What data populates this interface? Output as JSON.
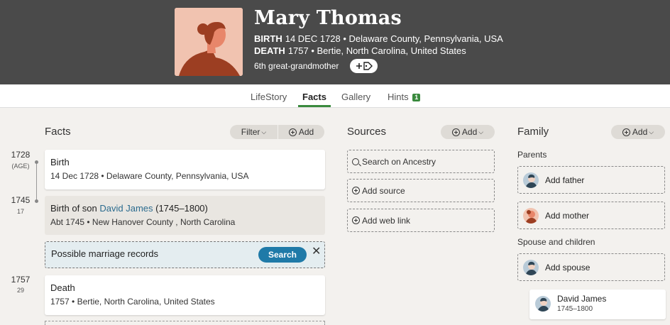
{
  "person": {
    "name": "Mary Thomas",
    "birth_label": "BIRTH",
    "birth_value": "14 DEC 1728 • Delaware County, Pennsylvania, USA",
    "death_label": "DEATH",
    "death_value": "1757 • Bertie, North Carolina, United States",
    "relationship": "6th great-grandmother"
  },
  "tabs": [
    {
      "label": "LifeStory"
    },
    {
      "label": "Facts",
      "active": true
    },
    {
      "label": "Gallery"
    },
    {
      "label": "Hints",
      "badge": "1"
    }
  ],
  "facts": {
    "title": "Facts",
    "filter_label": "Filter",
    "add_label": "Add",
    "timeline": [
      {
        "year": "1728",
        "age": "(AGE)"
      },
      {
        "year": "1745",
        "age": "17"
      },
      {
        "year": "1757",
        "age": "29"
      }
    ],
    "birth": {
      "title": "Birth",
      "detail": "14 Dec 1728 • Delaware County, Pennsylvania, USA"
    },
    "son_birth": {
      "title_prefix": "Birth of son ",
      "son_name": "David James",
      "son_dates": " (1745–1800)",
      "detail": "Abt 1745 • New Hanover County , North Carolina"
    },
    "marriage_hint": {
      "text": "Possible marriage records",
      "search_label": "Search"
    },
    "death": {
      "title": "Death",
      "detail": "1757 • Bertie, North Carolina, United States"
    }
  },
  "sources": {
    "title": "Sources",
    "add_label": "Add",
    "items": [
      "Search on Ancestry",
      "Add source",
      "Add web link"
    ]
  },
  "family": {
    "title": "Family",
    "add_label": "Add",
    "parents_label": "Parents",
    "add_father": "Add father",
    "add_mother": "Add mother",
    "spouse_label": "Spouse and children",
    "add_spouse": "Add spouse",
    "child": {
      "name": "David James",
      "dates": "1745–1800"
    }
  },
  "colors": {
    "header_bg": "#4a4a4a",
    "accent_green": "#3a8a3e",
    "search_blue": "#1f7aa8",
    "link_blue": "#2b6b8e"
  }
}
